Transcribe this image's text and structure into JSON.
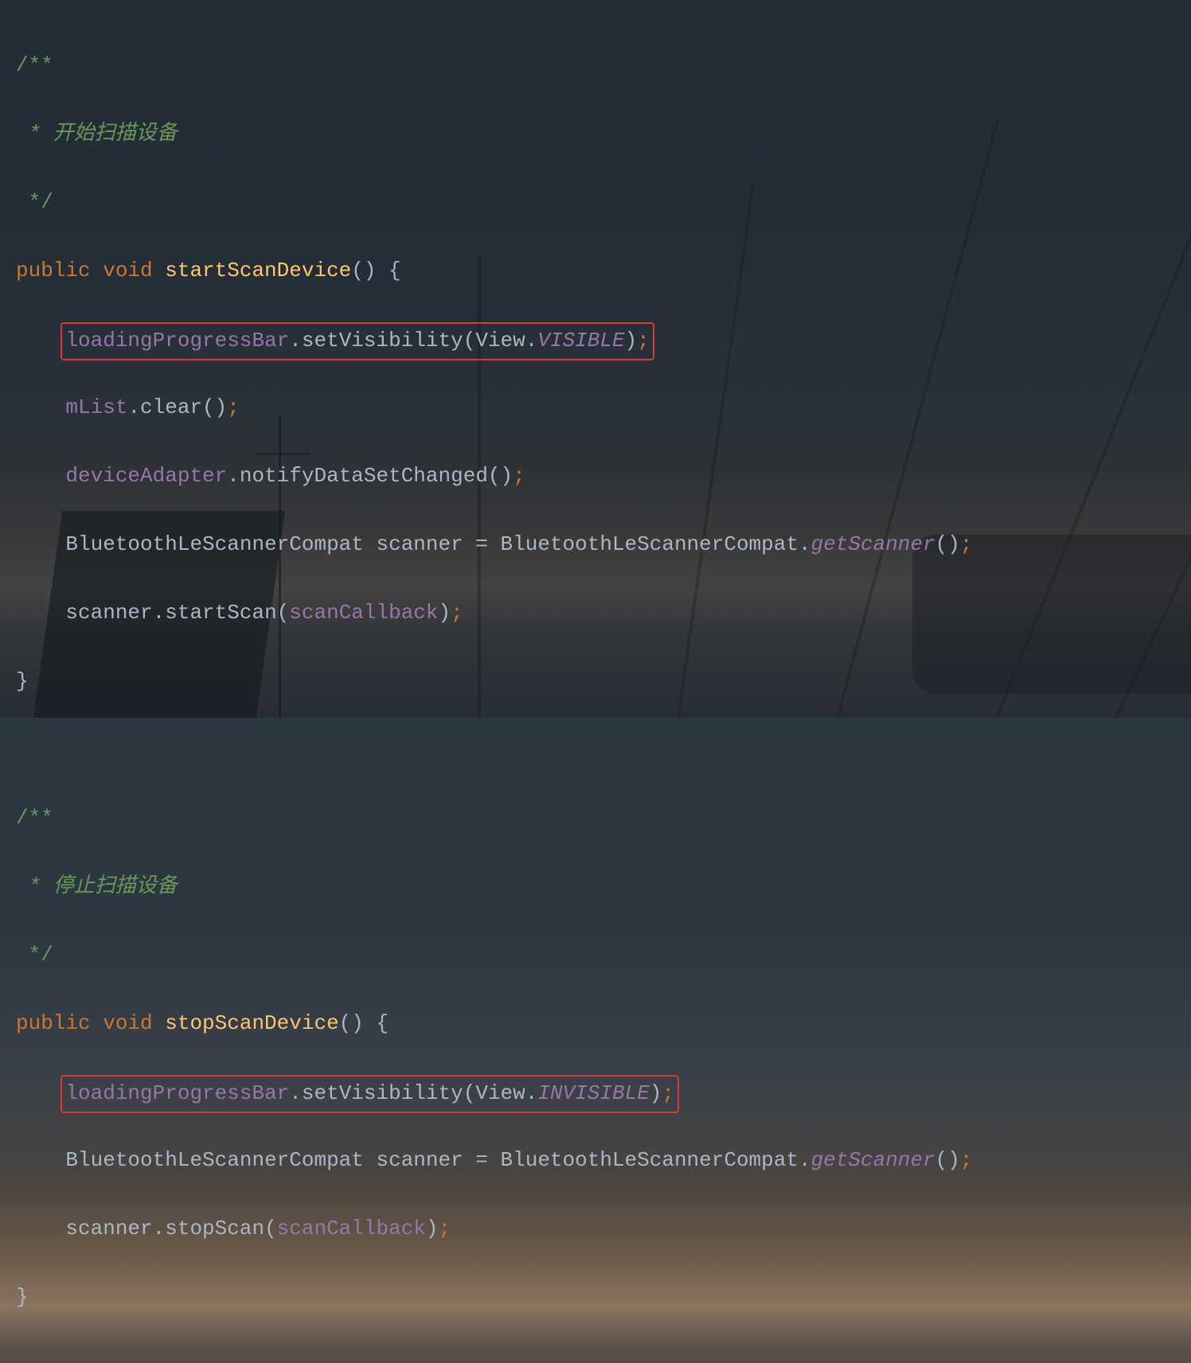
{
  "code": {
    "comment_open": "/**",
    "comment_start1": " * 开始扫描设备",
    "comment_close": " */",
    "method1_sig_public": "public ",
    "method1_sig_void": "void ",
    "method1_name": "startScanDevice",
    "method1_sig_end": "() {",
    "line1_field": "loadingProgressBar",
    "line1_dot": ".",
    "line1_method": "setVisibility",
    "line1_open": "(View.",
    "line1_const": "VISIBLE",
    "line1_close": ")",
    "line1_semi": ";",
    "line2_field": "mList",
    "line2_rest": ".clear()",
    "line2_semi": ";",
    "line3_field": "deviceAdapter",
    "line3_rest": ".notifyDataSetChanged()",
    "line3_semi": ";",
    "line4_type1": "BluetoothLeScannerCompat scanner = BluetoothLeScannerCompat.",
    "line4_getscanner": "getScanner",
    "line4_close": "()",
    "line4_semi": ";",
    "line5_rest": "scanner.startScan(",
    "line5_param": "scanCallback",
    "line5_close": ")",
    "line5_semi": ";",
    "close_brace": "}",
    "comment_start2": " * 停止扫描设备",
    "method2_name": "stopScanDevice",
    "line6_field": "loadingProgressBar",
    "line6_method": "setVisibility",
    "line6_open": "(View.",
    "line6_const": "INVISIBLE",
    "line6_close": ")",
    "line6_semi": ";",
    "line7_rest": "scanner.stopScan(",
    "line7_param": "scanCallback",
    "line7_close": ")",
    "line7_semi": ";"
  }
}
